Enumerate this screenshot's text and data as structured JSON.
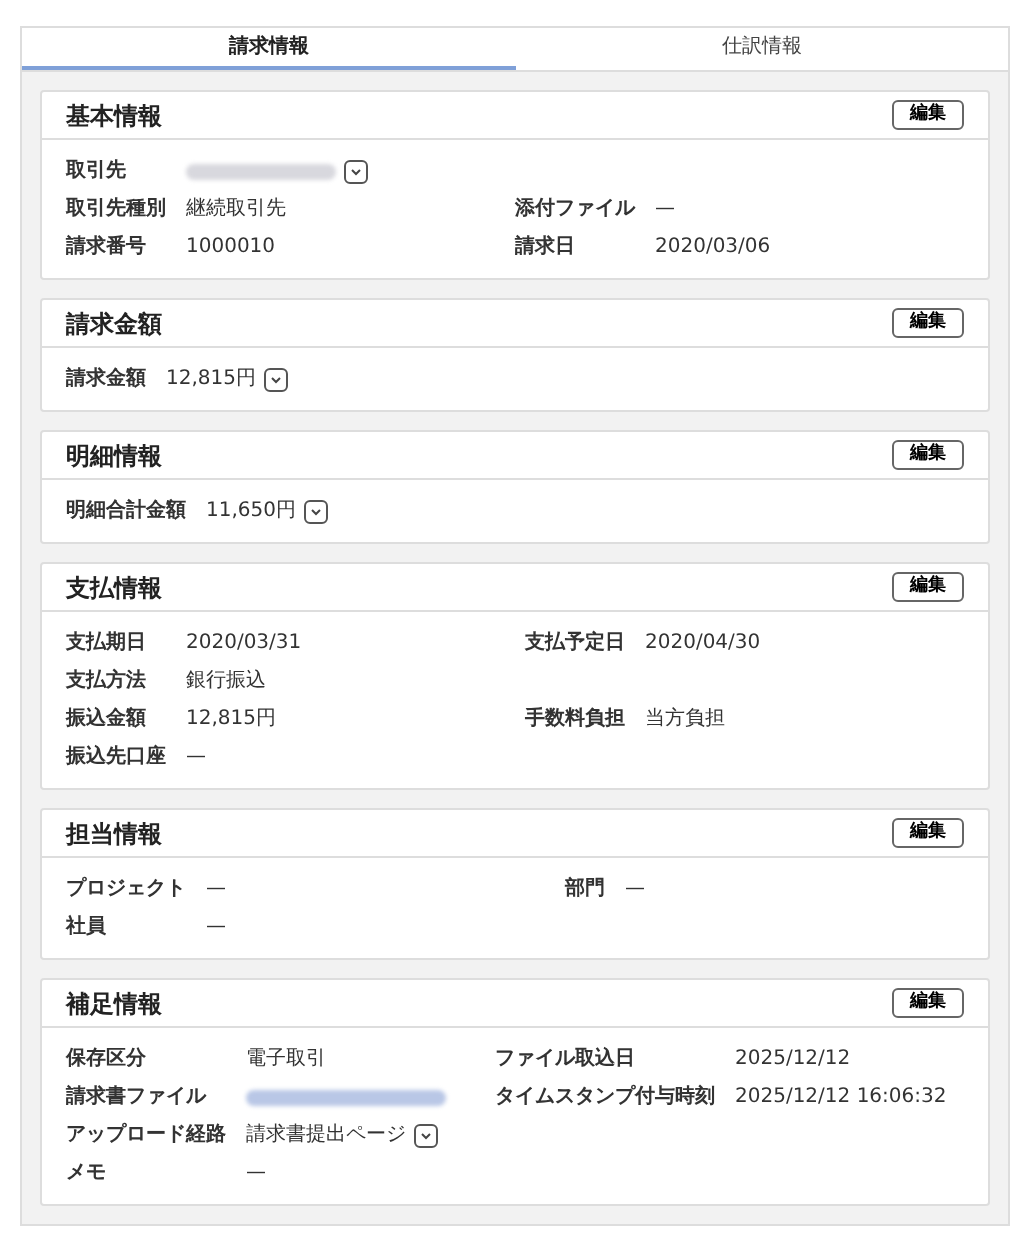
{
  "tabs": [
    {
      "label": "請求情報",
      "selected": true
    },
    {
      "label": "仕訳情報",
      "selected": false
    }
  ],
  "sections": [
    {
      "title": "基本情報",
      "edit_button": "編集",
      "rows": [
        [
          {
            "label": "取引先",
            "kind": "redacted",
            "dropdown": true
          },
          null
        ],
        [
          {
            "label": "取引先種別",
            "kind": "text",
            "value": "継続取引先",
            "dropdown": false
          },
          {
            "label": "添付ファイル",
            "kind": "text",
            "value": "—",
            "dropdown": false
          }
        ],
        [
          {
            "label": "請求番号",
            "kind": "text",
            "value": "1000010",
            "dropdown": false
          },
          {
            "label": "請求日",
            "kind": "text",
            "value": "2020/03/06",
            "dropdown": false
          }
        ]
      ]
    },
    {
      "title": "請求金額",
      "edit_button": "編集",
      "rows": [
        [
          {
            "label": "請求金額",
            "kind": "text",
            "value": "12,815円",
            "dropdown": true
          },
          null
        ]
      ]
    },
    {
      "title": "明細情報",
      "edit_button": "編集",
      "rows": [
        [
          {
            "label": "明細合計金額",
            "kind": "text",
            "value": "11,650円",
            "dropdown": true
          },
          null
        ]
      ]
    },
    {
      "title": "支払情報",
      "edit_button": "編集",
      "rows": [
        [
          {
            "label": "支払期日",
            "kind": "text",
            "value": "2020/03/31",
            "dropdown": false
          },
          {
            "label": "支払予定日",
            "kind": "text",
            "value": "2020/04/30",
            "dropdown": false
          }
        ],
        [
          {
            "label": "支払方法",
            "kind": "text",
            "value": "銀行振込",
            "dropdown": false
          },
          null
        ],
        [
          {
            "label": "振込金額",
            "kind": "text",
            "value": "12,815円",
            "dropdown": false
          },
          {
            "label": "手数料負担",
            "kind": "text",
            "value": "当方負担",
            "dropdown": false
          }
        ],
        [
          {
            "label": "振込先口座",
            "kind": "text",
            "value": "—",
            "dropdown": false
          },
          null
        ]
      ]
    },
    {
      "title": "担当情報",
      "edit_button": "編集",
      "rows": [
        [
          {
            "label": "プロジェクト",
            "kind": "text",
            "value": "—",
            "dropdown": false
          },
          {
            "label": "部門",
            "kind": "text",
            "value": "—",
            "dropdown": false
          }
        ],
        [
          {
            "label": "社員",
            "kind": "text",
            "value": "—",
            "dropdown": false
          },
          null
        ]
      ]
    },
    {
      "title": "補足情報",
      "edit_button": "編集",
      "rows": [
        [
          {
            "label": "保存区分",
            "kind": "text",
            "value": "電子取引",
            "dropdown": false
          },
          {
            "label": "ファイル取込日",
            "kind": "text",
            "value": "2025/12/12",
            "dropdown": false
          }
        ],
        [
          {
            "label": "請求書ファイル",
            "kind": "redacted-link",
            "dropdown": false
          },
          {
            "label": "タイムスタンプ付与時刻",
            "kind": "text",
            "value": "2025/12/12 16:06:32",
            "dropdown": false
          }
        ],
        [
          {
            "label": "アップロード経路",
            "kind": "text",
            "value": "請求書提出ページ",
            "dropdown": true
          },
          null
        ],
        [
          {
            "label": "メモ",
            "kind": "text",
            "value": "—",
            "dropdown": false
          },
          null
        ]
      ]
    }
  ]
}
